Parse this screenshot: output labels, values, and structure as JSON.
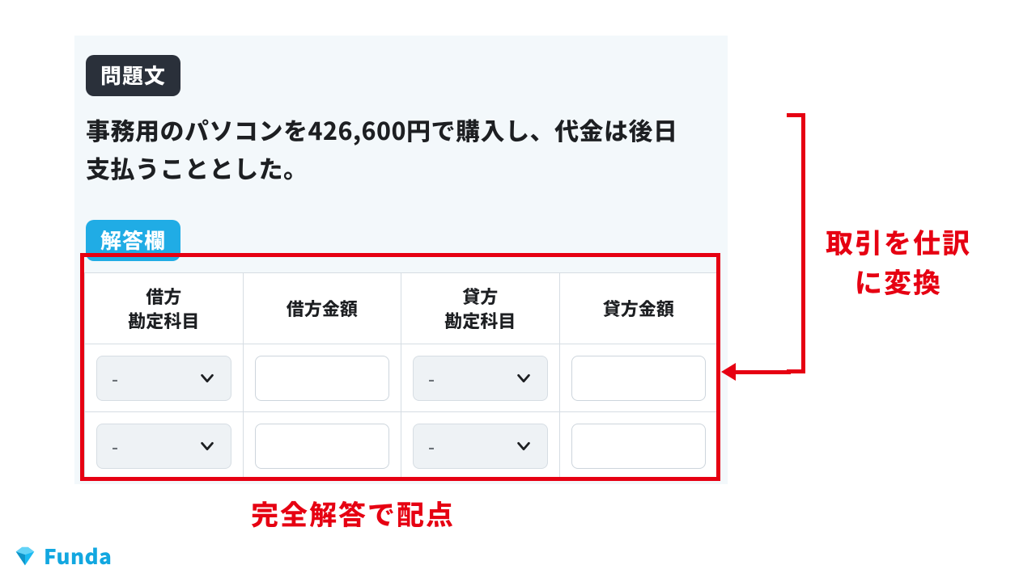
{
  "labels": {
    "question_pill": "問題文",
    "answer_pill": "解答欄"
  },
  "question_text": "事務用のパソコンを426,600円で購入し、代金は後日支払うこととした。",
  "table": {
    "headers": {
      "debit_account": "借方\n勘定科目",
      "debit_amount": "借方金額",
      "credit_account": "貸方\n勘定科目",
      "credit_amount": "貸方金額"
    },
    "rows": [
      {
        "debit_account": "-",
        "debit_amount": "",
        "credit_account": "-",
        "credit_amount": ""
      },
      {
        "debit_account": "-",
        "debit_amount": "",
        "credit_account": "-",
        "credit_amount": ""
      }
    ]
  },
  "annotations": {
    "side_line1": "取引を仕訳",
    "side_line2": "に変換",
    "bottom": "完全解答で配点"
  },
  "brand": {
    "name": "Funda"
  }
}
